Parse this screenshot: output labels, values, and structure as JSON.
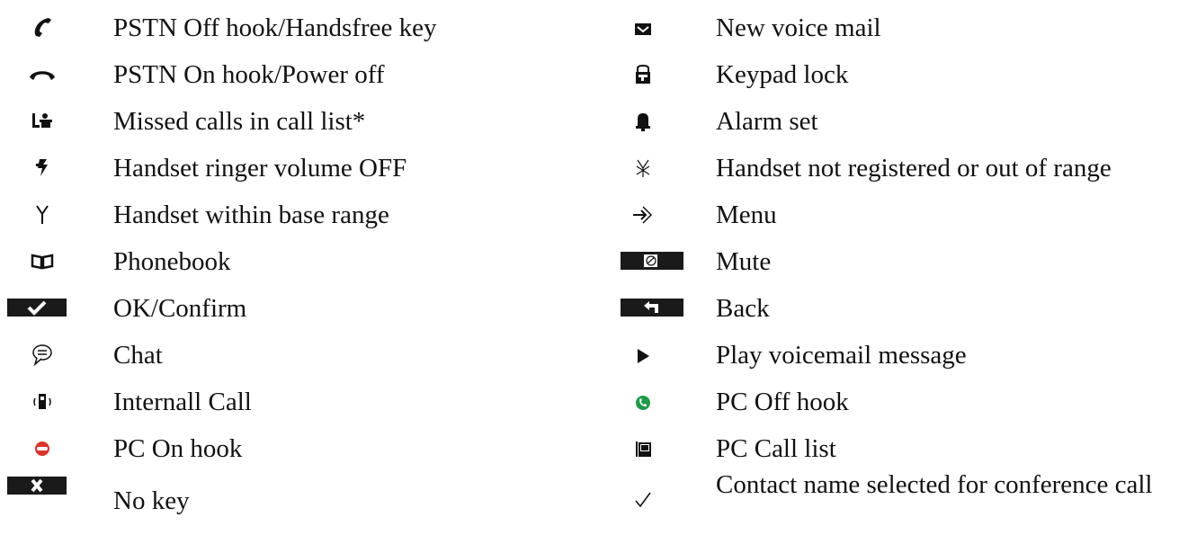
{
  "left_items": [
    {
      "icon": "pstn-off-hook-icon",
      "label": "PSTN Off hook/Handsfree key"
    },
    {
      "icon": "pstn-on-hook-icon",
      "label": "PSTN On hook/Power off"
    },
    {
      "icon": "missed-calls-icon",
      "label": "Missed calls in call list*"
    },
    {
      "icon": "ringer-off-icon",
      "label": "Handset ringer volume OFF"
    },
    {
      "icon": "antenna-icon",
      "label": "Handset within base range"
    },
    {
      "icon": "phonebook-icon",
      "label": "Phonebook"
    },
    {
      "icon": "ok-key-icon",
      "label": "OK/Confirm"
    },
    {
      "icon": "chat-icon",
      "label": "Chat"
    },
    {
      "icon": "internal-call-icon",
      "label": "Internall Call"
    },
    {
      "icon": "pc-on-hook-icon",
      "label": "PC On hook"
    },
    {
      "icon": "no-key-icon",
      "label": "No key"
    }
  ],
  "right_items": [
    {
      "icon": "voicemail-icon",
      "label": "New voice mail"
    },
    {
      "icon": "keypad-lock-icon",
      "label": "Keypad lock"
    },
    {
      "icon": "alarm-bell-icon",
      "label": "Alarm set"
    },
    {
      "icon": "not-registered-icon",
      "label": "Handset not registered or out of range"
    },
    {
      "icon": "menu-arrow-icon",
      "label": "Menu"
    },
    {
      "icon": "mute-key-icon",
      "label": "Mute"
    },
    {
      "icon": "back-key-icon",
      "label": "Back"
    },
    {
      "icon": "play-icon",
      "label": "Play voicemail message"
    },
    {
      "icon": "pc-off-hook-icon",
      "label": "PC Off hook"
    },
    {
      "icon": "pc-call-list-icon",
      "label": "PC Call list"
    },
    {
      "icon": "checkmark-icon",
      "label": "Contact name selected for conference call"
    }
  ],
  "colors": {
    "text": "#111111",
    "key_bar": "#1a1a1a",
    "green": "#1e9a4a",
    "red": "#d9342b"
  }
}
